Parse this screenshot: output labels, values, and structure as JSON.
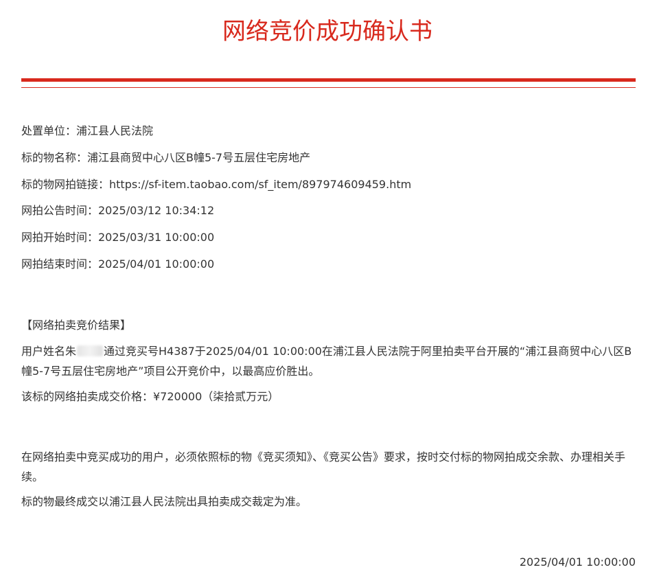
{
  "title": "网络竞价成功确认书",
  "info": {
    "unit": "处置单位：浦江县人民法院",
    "name": "标的物名称：浦江县商贸中心八区B幢5-7号五层住宅房地产",
    "link": "标的物网拍链接：https://sf-item.taobao.com/sf_item/897974609459.htm",
    "announce_time": "网拍公告时间：2025/03/12 10:34:12",
    "start_time": "网拍开始时间：2025/03/31 10:00:00",
    "end_time": "网拍结束时间：2025/04/01 10:00:00"
  },
  "result": {
    "heading": "【网络拍卖竞价结果】",
    "text_prefix": "用户姓名朱",
    "text_suffix": "通过竞买号H4387于2025/04/01 10:00:00在浦江县人民法院于阿里拍卖平台开展的“浦江县商贸中心八区B幢5-7号五层住宅房地产”项目公开竞价中，以最高应价胜出。",
    "price": "该标的网络拍卖成交价格：¥720000（柒拾贰万元）"
  },
  "notice": {
    "line1": "在网络拍卖中竞买成功的用户，必须依照标的物《竞买须知》、《竞买公告》要求，按时交付标的物网拍成交余款、办理相关手续。",
    "line2": "标的物最终成交以浦江县人民法院出具拍卖成交裁定为准。"
  },
  "sign_date": "2025/04/01 10:00:00",
  "colors": {
    "accent": "#d8291d",
    "text": "#333333"
  }
}
